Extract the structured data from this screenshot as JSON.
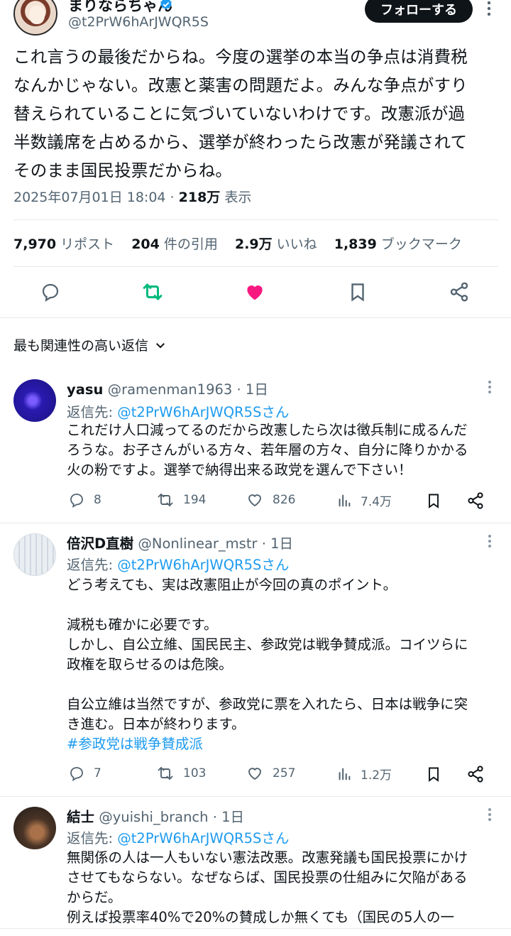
{
  "author": {
    "display_name": "まりならちゃん",
    "handle": "@t2PrW6hArJWQR5S",
    "follow_label": "フォローする"
  },
  "tweet": {
    "lines": [
      "これ言うの最後だからね。今度の選挙の本当の争点は消費税",
      "なんかじゃない。改憲と薬害の問題だよ。みんな争点がすり",
      "替えられていることに気づいていないわけです。改憲派が過",
      "半数議席を占めるから、選挙が終わったら改憲が発議されて",
      "そのまま国民投票だからね。"
    ],
    "timestamp": "2025年07月01日 18:04",
    "separator": " · ",
    "views": "218万",
    "views_label": " 表示"
  },
  "stats": {
    "reposts": "7,970",
    "reposts_label": " リポスト",
    "quotes": "204",
    "quotes_label": " 件の引用",
    "likes": "2.9万",
    "likes_label": " いいね",
    "bookmarks": "1,839",
    "bookmarks_label": " ブックマーク"
  },
  "sort": {
    "label": "最も関連性の高い返信"
  },
  "replies": [
    {
      "name": "yasu",
      "handle": "@ramenman1963",
      "time": " · 1日",
      "reply_to_label": "返信先: ",
      "reply_to": "@t2PrW6hArJWQR5Sさん",
      "body": [
        "これだけ人口減ってるのだから改憲したら次は徴兵制に成るんだ",
        "ろうな。お子さんがいる方々、若年層の方々、自分に降りかかる",
        "火の粉ですよ。選挙で納得出来る政党を選んで下さい！"
      ],
      "replies": "8",
      "reposts": "194",
      "likes": "826",
      "views": "7.4万"
    },
    {
      "name": "倍沢D直樹",
      "handle": "@Nonlinear_mstr",
      "time": " · 1日",
      "reply_to_label": "返信先: ",
      "reply_to": "@t2PrW6hArJWQR5Sさん",
      "body": [
        "どう考えても、実は改憲阻止が今回の真のポイント。",
        "",
        "減税も確かに必要です。",
        "しかし、自公立維、国民民主、参政党は戦争賛成派。コイツらに",
        "政権を取らせるのは危険。",
        "",
        "自公立維は当然ですが、参政党に票を入れたら、日本は戦争に突",
        "き進む。日本が終わります。"
      ],
      "hashtag": "#参政党は戦争賛成派",
      "replies": "7",
      "reposts": "103",
      "likes": "257",
      "views": "1.2万"
    },
    {
      "name": "結士",
      "handle": "@yuishi_branch",
      "time": " · 1日",
      "reply_to_label": "返信先: ",
      "reply_to": "@t2PrW6hArJWQR5Sさん",
      "body": [
        "無関係の人は一人もいない憲法改悪。改憲発議も国民投票にかけ",
        "させてもならない。なぜならば、国民投票の仕組みに欠陥がある",
        "からだ。",
        "例えば投票率40%で20%の賛成しか無くても（国民の5人の一"
      ]
    }
  ],
  "colors": {
    "accent": "#1d9bf0",
    "repost_green": "#00ba7c",
    "like_pink": "#f91880",
    "text": "#0f1419",
    "muted": "#536471"
  },
  "icons": [
    "verified-icon",
    "more-icon",
    "reply-icon",
    "repost-icon",
    "like-icon",
    "bookmark-icon",
    "share-icon",
    "chevron-down-icon",
    "views-icon"
  ]
}
